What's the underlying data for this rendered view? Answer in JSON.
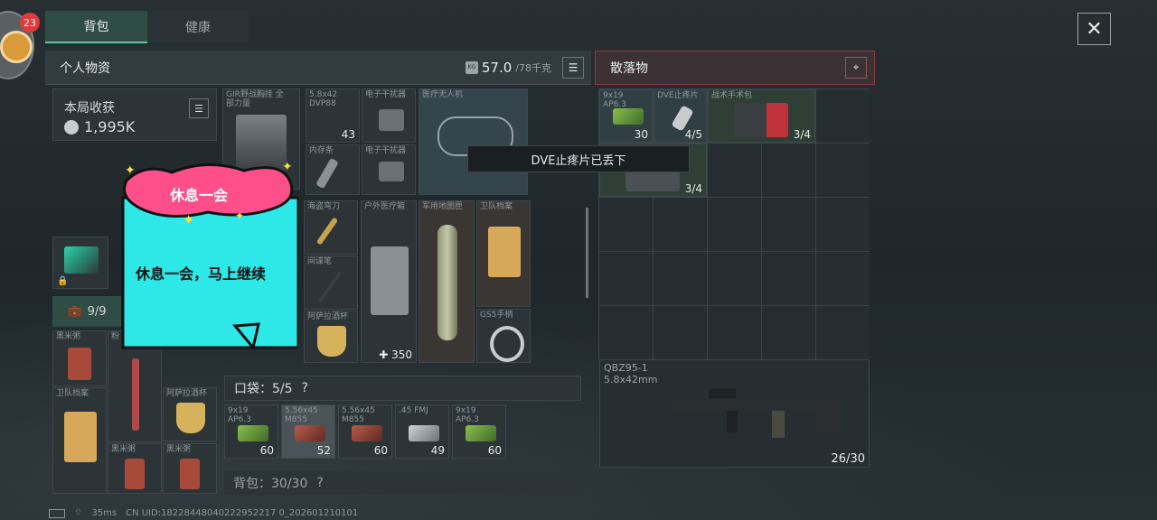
{
  "notification_count": "23",
  "tabs": [
    "背包",
    "健康"
  ],
  "personal": {
    "title": "个人物资",
    "weight_value": "57.0",
    "weight_capacity": "/78千克",
    "kg_badge": "KG"
  },
  "earnings": {
    "label": "本局收获",
    "value": "1,995K"
  },
  "slots": {
    "chest_rig": "GIR野战胸挂 全部力量",
    "s1": {
      "label": "5.8x42 DVP88",
      "count": "43"
    },
    "s2": {
      "label": "电子干扰器"
    },
    "s3": {
      "label": "内存条"
    },
    "s4": {
      "label": "电子干扰器"
    },
    "drone": "医疗无人机",
    "knife": "海盗弯刀",
    "medkit": {
      "label": "户外医疗箱",
      "count": "350"
    },
    "map_tube": "军用地图匣",
    "guard_file": "卫队档案",
    "spy_pen": "间谍笔",
    "gs5_headset": "GS5手柄",
    "cup": "阿萨拉酒杯"
  },
  "bag": {
    "count_label": "9/9"
  },
  "secure": {
    "items": [
      "黑米粥",
      "粉",
      "卫队档案",
      "阿萨拉酒杯",
      "黑米粥",
      "黑米粥"
    ]
  },
  "pocket": {
    "label": "口袋：5/5",
    "help": "?",
    "items": [
      {
        "label": "9x19 AP6.3",
        "count": "60"
      },
      {
        "label": "5.56x45 M855",
        "count": "52"
      },
      {
        "label": "5.56x45 M855",
        "count": "60"
      },
      {
        "label": ".45 FMJ",
        "count": "49"
      },
      {
        "label": "9x19 AP6.3",
        "count": "60"
      }
    ]
  },
  "backpack": {
    "label": "背包：30/30",
    "help": "?"
  },
  "loot": {
    "title": "散落物",
    "items": [
      {
        "label": "9x19 AP6.3",
        "count": "30"
      },
      {
        "label": "DVE止疼片",
        "count": "4/5"
      },
      {
        "label": "战术手术包",
        "count": "3/4"
      },
      {
        "label": "",
        "count": "3/4"
      }
    ],
    "weapon": {
      "name": "QBZ95-1",
      "caliber": "5.8x42mm",
      "ammo": "26/30"
    }
  },
  "toast": "DVE止疼片已丢下",
  "sticker": {
    "heading": "休息一会",
    "body": "休息一会，马上继续"
  },
  "footer": {
    "ping": "35ms",
    "uid": "CN UID:18228448040222952217 0_202601210101"
  },
  "colors": {
    "accent": "#68c4a0",
    "loot_border": "#8a3a42",
    "badge": "#e03b3b",
    "sticker_pink": "#ff4f8b",
    "sticker_cyan": "#2ee8e8"
  }
}
